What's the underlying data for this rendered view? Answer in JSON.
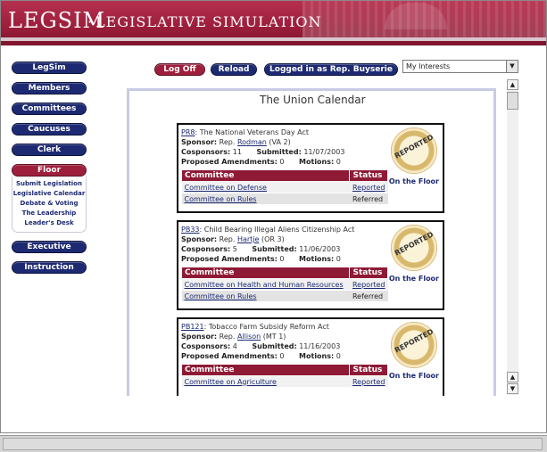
{
  "banner": {
    "brand": "LEGSIM",
    "separator": "·",
    "subtitle": "LEGISLATIVE SIMULATION"
  },
  "nav": {
    "items": [
      "LegSim",
      "Members",
      "Committees",
      "Caucuses",
      "Clerk"
    ],
    "floor": "Floor",
    "floor_menu": [
      "Submit Legislation",
      "Legislative Calendar",
      "Debate & Voting",
      "The Leadership",
      "Leader's Desk"
    ],
    "lower": [
      "Executive",
      "Instruction"
    ]
  },
  "topbar": {
    "logoff": "Log Off",
    "reload": "Reload",
    "logged_in": "Logged in as Rep. Buyserie",
    "interests": {
      "value": "My Interests",
      "arrow": "▼"
    }
  },
  "main": {
    "title": "The Union Calendar",
    "labels": {
      "sponsor": "Sponsor:",
      "cosponsors": "Cosponsors:",
      "submitted": "Submitted:",
      "amendments": "Proposed Amendments:",
      "motions": "Motions:",
      "committee_header": "Committee",
      "status_header": "Status",
      "on_floor": "On the Floor",
      "stamp": "REPORTED"
    },
    "bills": [
      {
        "id": "PR8",
        "title": ": The National Veterans Day Act",
        "sponsor_prefix": "Rep. ",
        "sponsor": "Rodman",
        "sponsor_suffix": " (VA 2)",
        "cosponsors": "11",
        "submitted": "11/07/2003",
        "amendments": "0",
        "motions": "0",
        "committees": [
          {
            "name": "Committee on Defense",
            "status": "Reported"
          },
          {
            "name": "Committee on Rules",
            "status": "Referred"
          }
        ]
      },
      {
        "id": "PB33",
        "title": ": Child Bearing Illegal Aliens Citizenship Act",
        "sponsor_prefix": "Rep. ",
        "sponsor": "Hartje",
        "sponsor_suffix": " (OR 3)",
        "cosponsors": "5",
        "submitted": "11/06/2003",
        "amendments": "0",
        "motions": "0",
        "committees": [
          {
            "name": "Committee on Health and Human Resources",
            "status": "Reported"
          },
          {
            "name": "Committee on Rules",
            "status": "Referred"
          }
        ]
      },
      {
        "id": "PB121",
        "title": ": Tobacco Farm Subsidy Reform Act",
        "sponsor_prefix": "Rep. ",
        "sponsor": "Allison",
        "sponsor_suffix": " (MT 1)",
        "cosponsors": "4",
        "submitted": "11/16/2003",
        "amendments": "0",
        "motions": "0",
        "committees": [
          {
            "name": "Committee on Agriculture",
            "status": "Reported"
          }
        ]
      }
    ]
  },
  "scrollbar": {
    "up": "▲",
    "down": "▼"
  },
  "colors": {
    "maroon": "#9e1f3c",
    "navy": "#1d2a72",
    "panel_border": "#c8cbe5"
  }
}
